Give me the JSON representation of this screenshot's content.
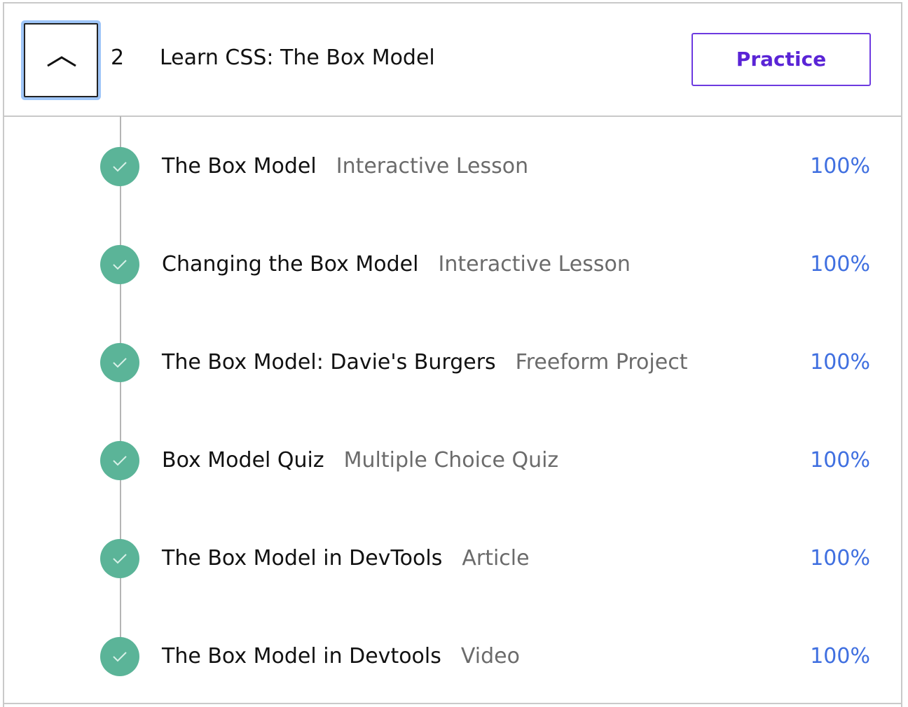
{
  "module": {
    "number": "2",
    "title": "Learn CSS: The Box Model",
    "toggle_icon": "chevron-up-icon",
    "practice_label": "Practice"
  },
  "colors": {
    "accent": "#5a24d6",
    "complete": "#5bb498",
    "percent": "#3f6fe0"
  },
  "lessons": [
    {
      "title": "The Box Model",
      "type": "Interactive Lesson",
      "progress": "100%",
      "icon": "check-icon"
    },
    {
      "title": "Changing the Box Model",
      "type": "Interactive Lesson",
      "progress": "100%",
      "icon": "check-icon"
    },
    {
      "title": "The Box Model: Davie's Burgers",
      "type": "Freeform Project",
      "progress": "100%",
      "icon": "check-icon"
    },
    {
      "title": "Box Model Quiz",
      "type": "Multiple Choice Quiz",
      "progress": "100%",
      "icon": "check-icon"
    },
    {
      "title": "The Box Model in DevTools",
      "type": "Article",
      "progress": "100%",
      "icon": "check-icon"
    },
    {
      "title": "The Box Model in Devtools",
      "type": "Video",
      "progress": "100%",
      "icon": "check-icon"
    }
  ]
}
